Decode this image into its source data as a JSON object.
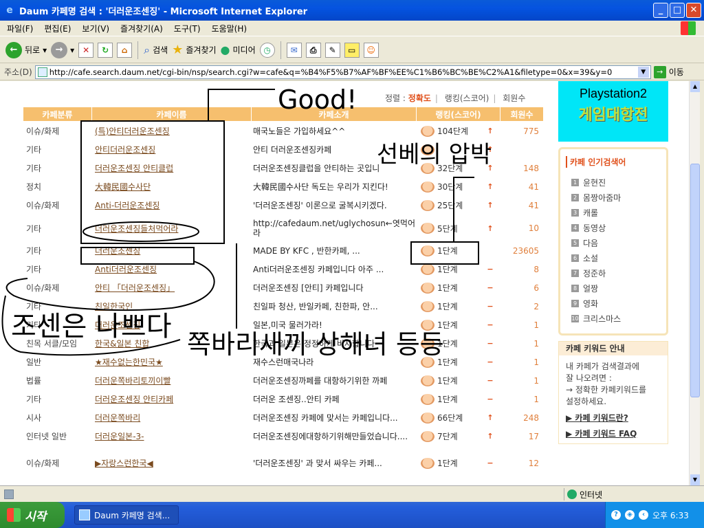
{
  "window": {
    "title": "Daum 카페명 검색 : '더러운조센징' - Microsoft Internet Explorer"
  },
  "menu": [
    "파일(F)",
    "편집(E)",
    "보기(V)",
    "즐겨찾기(A)",
    "도구(T)",
    "도움말(H)"
  ],
  "toolbar": {
    "back": "뒤로",
    "search": "검색",
    "favorites": "즐겨찾기",
    "media": "미디어"
  },
  "address": {
    "label": "주소(D)",
    "url": "http://cafe.search.daum.net/cgi-bin/nsp/search.cgi?w=cafe&q=%B4%F5%B7%AF%BF%EE%C1%B6%BC%BE%C2%A1&filetype=0&x=39&y=0",
    "go": "이동"
  },
  "sort": {
    "label": "정렬 :",
    "accuracy": "정확도",
    "ranking": "랭킹(스코어)",
    "members": "회원수"
  },
  "table": {
    "headers": [
      "카페분류",
      "카페이름",
      "카페소개",
      "랭킹(스코어)",
      "회원수"
    ],
    "rows": [
      {
        "cat": "이슈/화제",
        "name": "(특)안티더러운조센징",
        "intro": "매국노들은 가입하세요^^",
        "rank": "104단계",
        "arrow": "↑",
        "members": "775"
      },
      {
        "cat": "기타",
        "name": "안티더러운조센징",
        "intro": "안티 더러운조센징카페",
        "rank": "",
        "arrow": "↑",
        "members": ""
      },
      {
        "cat": "기타",
        "name": "더러운조센징 안티클럽",
        "intro": "더러운조센징클럽을 안티하는 곳입니",
        "rank": "32단계",
        "arrow": "↑",
        "members": "148"
      },
      {
        "cat": "정치",
        "name": "大韓民國수사단",
        "intro": "大韓民國수사단 독도는 우리가 지킨다!",
        "rank": "30단계",
        "arrow": "↑",
        "members": "41"
      },
      {
        "cat": "이슈/화제",
        "name": "Anti-더러운조센징",
        "intro": "'더러운조센징' 이론으로 굴복시키겠다.",
        "rank": "25단계",
        "arrow": "↑",
        "members": "41"
      },
      {
        "cat": "기타",
        "name": "더러운조센징들처먹어라",
        "intro": "http://cafedaum.net/uglychosun←엿먹어라",
        "rank": "5단계",
        "arrow": "↑",
        "members": "10"
      },
      {
        "cat": "기타",
        "name": "더러운조센징",
        "intro": "MADE BY KFC , 반한카페, ...",
        "rank": "1단계",
        "arrow": "",
        "members": "23605"
      },
      {
        "cat": "기타",
        "name": "Anti더러운조센징",
        "intro": "Anti더러운조센징 카페입니다 아주 ...",
        "rank": "1단계",
        "arrow": "−",
        "members": "8"
      },
      {
        "cat": "이슈/화제",
        "name": "안티 「더러운조센징」",
        "intro": "더러운조센징 [안티] 카페입니다",
        "rank": "1단계",
        "arrow": "−",
        "members": "6"
      },
      {
        "cat": "기타",
        "name": "친일한국인",
        "intro": "친일파 청산, 반일카페, 친한파, 안...",
        "rank": "1단계",
        "arrow": "−",
        "members": "2"
      },
      {
        "cat": "기타",
        "name": "더러운조센징",
        "intro": "일본,미국 물러가라!",
        "rank": "1단계",
        "arrow": "−",
        "members": "1"
      },
      {
        "cat": "친목 서클/모임",
        "name": "한국&일본 친합",
        "intro": "한국과 일본은 정정하게 비자합니다",
        "rank": "1단계",
        "arrow": "−",
        "members": "1"
      },
      {
        "cat": "일반",
        "name": "★재수없는한민국★",
        "intro": "재수스런매국나라",
        "rank": "1단계",
        "arrow": "−",
        "members": "1"
      },
      {
        "cat": "법률",
        "name": "더러운쪽바리토끼이빨",
        "intro": "더러운조센징까페를 대항하기위한 까페",
        "rank": "1단계",
        "arrow": "−",
        "members": "1"
      },
      {
        "cat": "기타",
        "name": "더러운조센징 안티카페",
        "intro": "더러운 조센징..안티 카페",
        "rank": "1단계",
        "arrow": "−",
        "members": "1"
      },
      {
        "cat": "시사",
        "name": "더러운쪽바리",
        "intro": "더러운조센징 카페에 맞서는 카페입니다...",
        "rank": "66단계",
        "arrow": "↑",
        "members": "248"
      },
      {
        "cat": "인터넷 일반",
        "name": "더러운일본-3-",
        "intro": "더러운조센징에대항하기위해만들었습니다....",
        "rank": "7단계",
        "arrow": "↑",
        "members": "17"
      },
      {
        "cat": "이슈/화제",
        "name": "▶자랑스런한국◀",
        "intro": "'더러운조센징' 과 맞서 싸우는 카페...",
        "rank": "1단계",
        "arrow": "−",
        "members": "12"
      }
    ]
  },
  "ad": {
    "line1": "Playstation2",
    "line2": "게임대항전"
  },
  "popular": {
    "title": "카페 인기검색어",
    "items": [
      "윤현진",
      "몸짱아줌마",
      "캐롤",
      "동영상",
      "다음",
      "소설",
      "정준하",
      "얼짱",
      "영화",
      "크리스마스"
    ]
  },
  "keyword_guide": {
    "title": "카페 키워드 안내",
    "text1": "내 카페가 검색결과에",
    "text2": "잘 나오려면 :",
    "text3": "→ 정확한 카페키워드를",
    "text4": "설정하세요.",
    "link1": "▶ 카페 키워드란?",
    "link2": "▶ 카페 키워드 FAQ"
  },
  "annotations": {
    "good": "Good!",
    "top_right": "선베의 압박",
    "bottom_left": "조센은 나쁘다",
    "bottom_main": "쪽바리새끼 상해녀 등등"
  },
  "status": {
    "zone": "인터넷"
  },
  "taskbar": {
    "start": "시작",
    "task": "Daum 카페명 검색...",
    "clock": "오후 6:33"
  }
}
